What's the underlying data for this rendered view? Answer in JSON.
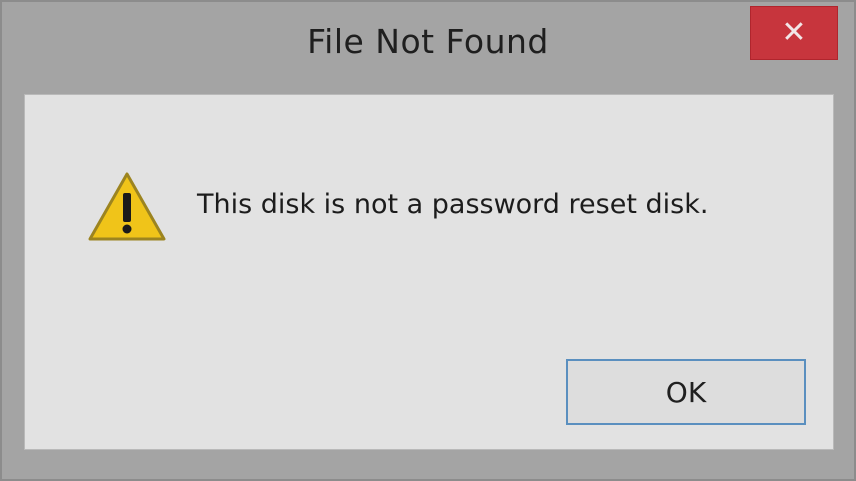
{
  "window": {
    "title": "File Not Found",
    "close_label": "✕"
  },
  "dialog": {
    "icon": "warning-icon",
    "message": "This disk is not a password reset disk.",
    "ok_label": "OK"
  },
  "colors": {
    "close_button": "#c7353d",
    "ok_border": "#5a8fbf",
    "warning_yellow": "#f0c419"
  }
}
